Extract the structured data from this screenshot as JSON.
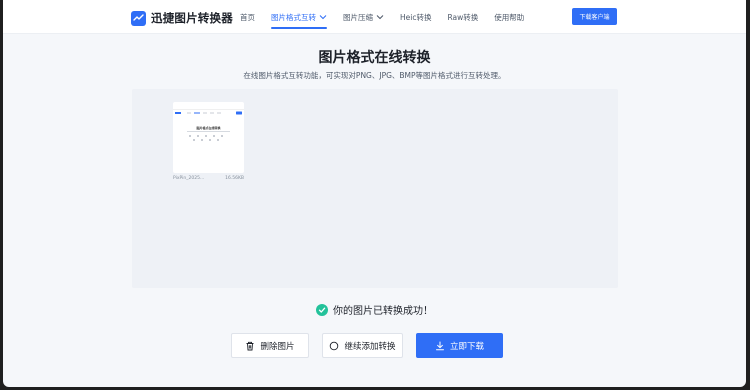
{
  "app": {
    "name": "迅捷图片转换器",
    "brand_color": "#2f6ef6"
  },
  "nav": {
    "items": [
      {
        "label": "首页",
        "active": false,
        "dropdown": false
      },
      {
        "label": "图片格式互转",
        "active": true,
        "dropdown": true
      },
      {
        "label": "图片压缩",
        "active": false,
        "dropdown": true
      },
      {
        "label": "Heic转换",
        "active": false,
        "dropdown": false
      },
      {
        "label": "Raw转换",
        "active": false,
        "dropdown": false
      },
      {
        "label": "使用帮助",
        "active": false,
        "dropdown": false
      }
    ],
    "download_button": "下载客户端"
  },
  "page": {
    "title": "图片格式在线转换",
    "subtitle": "在线图片格式互转功能，可实现对PNG、JPG、BMP等图片格式进行互转处理。"
  },
  "files": [
    {
      "name": "PixPin_2025...",
      "size": "16.56KB",
      "preview_title": "图片格式在线转换"
    }
  ],
  "status": {
    "text": "你的图片已转换成功！",
    "color": "#23c29a"
  },
  "actions": {
    "delete_label": "删除图片",
    "continue_label": "继续添加转换",
    "download_label": "立即下载"
  }
}
